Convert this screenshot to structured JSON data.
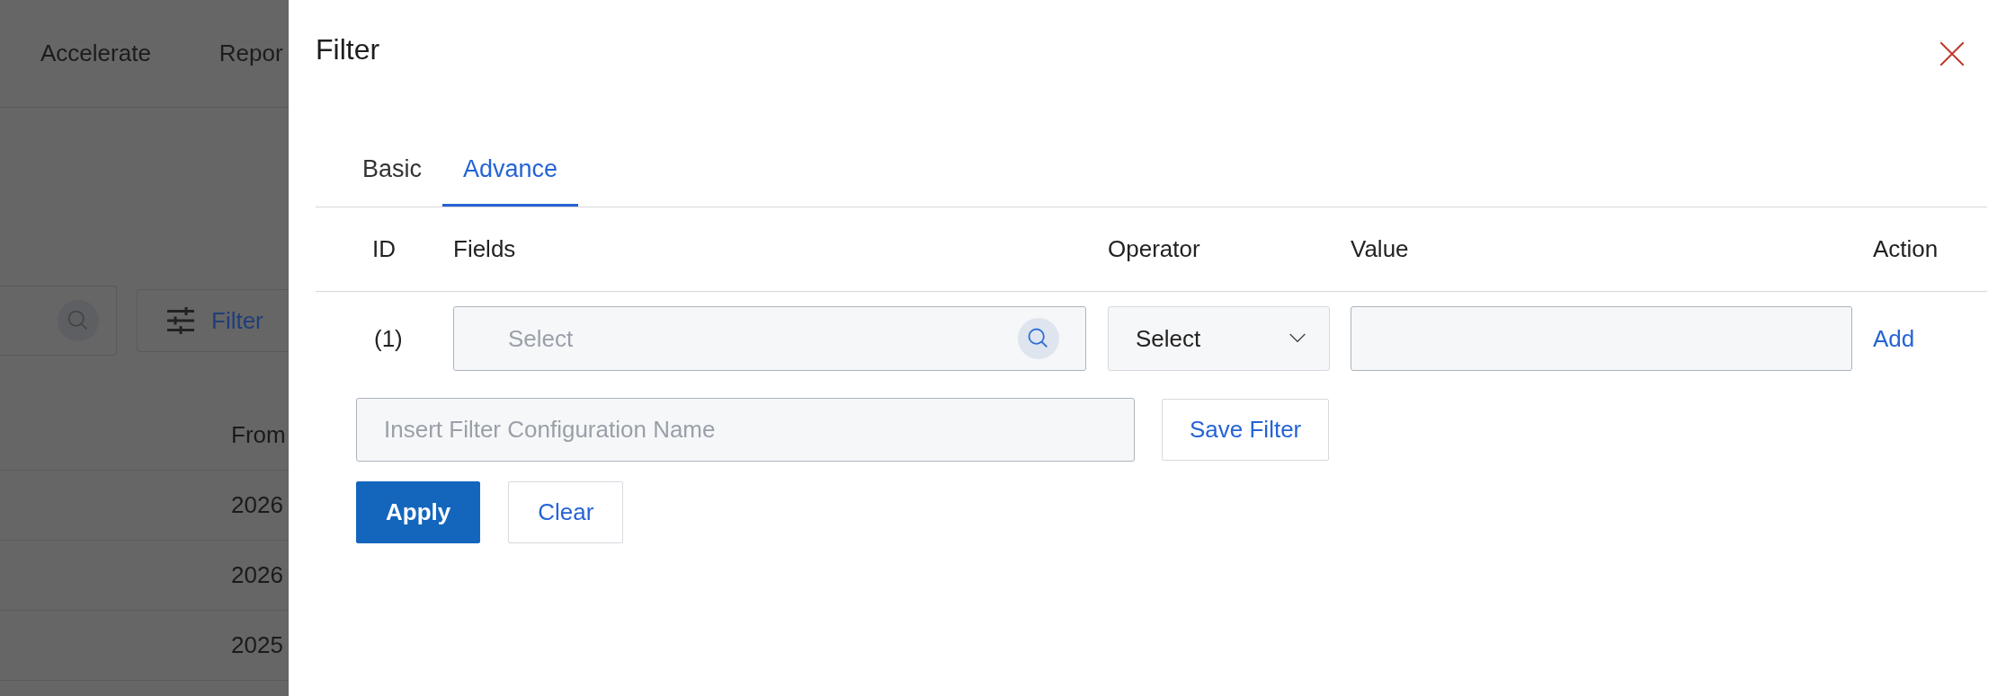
{
  "background_page": {
    "nav": [
      "Accelerate",
      "Repor"
    ],
    "filter_button": "Filter",
    "table": {
      "columns": [
        "From"
      ],
      "rows": [
        [
          "2026"
        ],
        [
          "2026"
        ],
        [
          "2025"
        ]
      ]
    }
  },
  "panel": {
    "title": "Filter",
    "tabs": [
      {
        "label": "Basic",
        "selected": false
      },
      {
        "label": "Advance",
        "selected": true
      }
    ],
    "columns": [
      "ID",
      "Fields",
      "Operator",
      "Value",
      "Action"
    ],
    "rows": [
      {
        "id": "(1)",
        "field": {
          "placeholder": "Select"
        },
        "operator": "Select",
        "action": "Add"
      }
    ],
    "config_name": {
      "placeholder": "Insert Filter Configuration Name"
    },
    "save_button": "Save Filter",
    "buttons": [
      {
        "label": "Apply",
        "kind": "primary"
      },
      {
        "label": "Clear",
        "kind": "secondary"
      }
    ]
  }
}
